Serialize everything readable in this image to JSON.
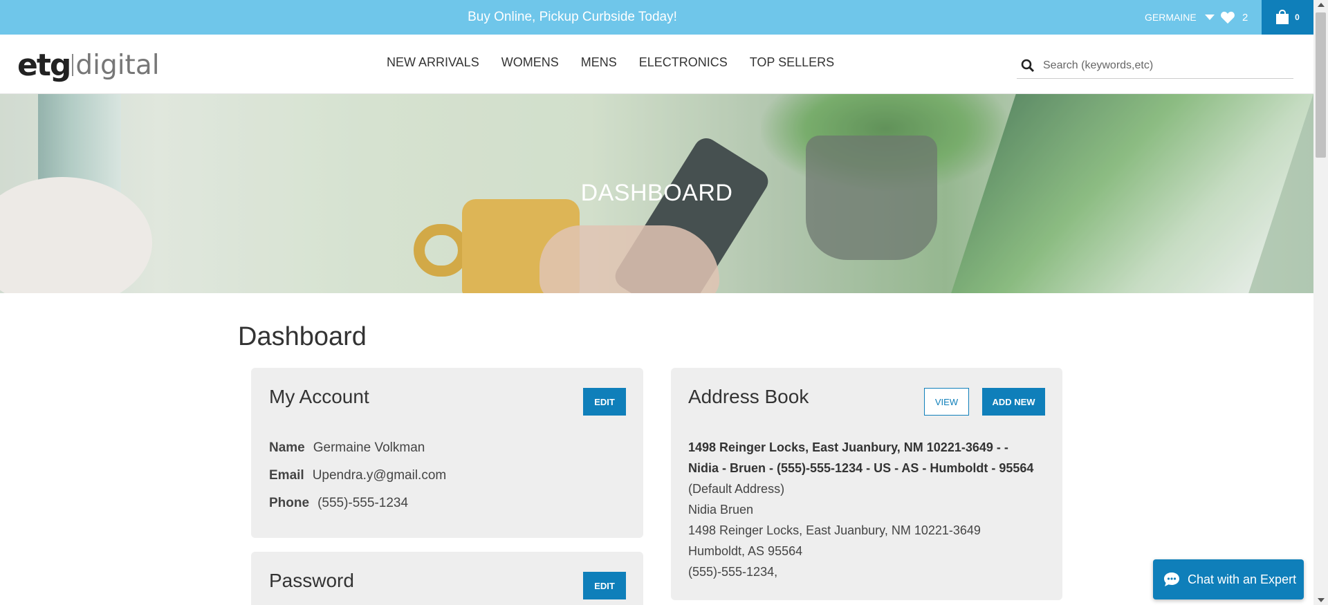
{
  "topbar": {
    "promo": "Buy Online, Pickup Curbside Today!",
    "user_name": "GERMAINE",
    "wishlist_count": "2",
    "cart_count": "0"
  },
  "header": {
    "logo_strong": "etg",
    "logo_light": "digital",
    "nav": [
      "NEW ARRIVALS",
      "WOMENS",
      "MENS",
      "ELECTRONICS",
      "TOP SELLERS"
    ],
    "search_placeholder": "Search (keywords,etc)"
  },
  "hero": {
    "title": "DASHBOARD"
  },
  "main": {
    "title": "Dashboard",
    "account": {
      "heading": "My Account",
      "edit_label": "EDIT",
      "name_label": "Name",
      "name_value": "Germaine Volkman",
      "email_label": "Email",
      "email_value": "Upendra.y@gmail.com",
      "phone_label": "Phone",
      "phone_value": "(555)-555-1234"
    },
    "password": {
      "heading": "Password",
      "edit_label": "EDIT"
    },
    "address_book": {
      "heading": "Address Book",
      "view_label": "VIEW",
      "add_label": "ADD NEW",
      "summary_line1": "1498 Reinger Locks, East Juanbury, NM 10221-3649 - -",
      "summary_line2": "Nidia - Bruen - (555)-555-1234 - US - AS - Humboldt - 95564",
      "default_note": "(Default Address)",
      "recipient": "Nidia  Bruen",
      "street": "1498 Reinger Locks, East Juanbury, NM 10221-3649",
      "city_line": "Humboldt,  AS  95564",
      "phone": "(555)-555-1234,"
    }
  },
  "chat": {
    "label": "Chat with an Expert"
  },
  "colors": {
    "topbar": "#6fc6ea",
    "primary": "#0f7fba",
    "card": "#eeeeee"
  }
}
